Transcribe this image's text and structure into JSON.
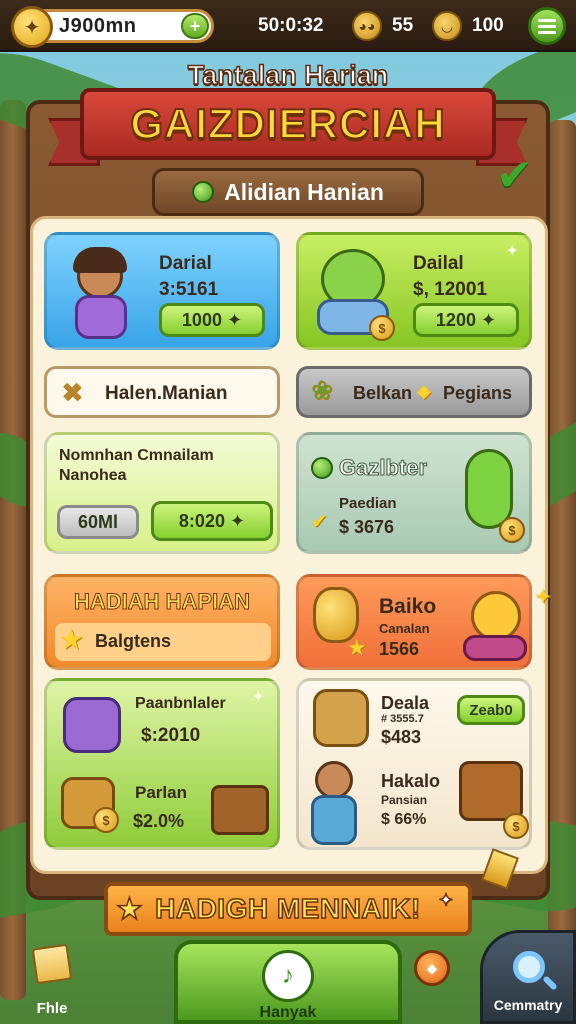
{
  "topbar": {
    "currency_left": "J900mn",
    "timer": "50:0:32",
    "currency_mid": "55",
    "currency_right": "100"
  },
  "header": {
    "title_small": "Tantalan Harian",
    "title_big": "GAIZDIERCIAH",
    "subheading": "Alidian Hanian"
  },
  "cards": {
    "c1": {
      "line1": "Darial",
      "line2": "3:5161",
      "btn": "1000"
    },
    "c2": {
      "line1": "Dailal",
      "line2": "$, 12001",
      "btn": "1200"
    },
    "tab_left": "Halen.Manian",
    "tab_right": "Belkan",
    "tab_right_2": "Pegians",
    "c3": {
      "line1": "Nomnhan Cmnailam",
      "line2": "Nanohea",
      "btn_grey": "60Ml",
      "btn_green": "8:020"
    },
    "c4": {
      "title": "Gazlbter",
      "line1": "Paedian",
      "line2": "$ 3676"
    },
    "c5": {
      "title": "HADIAH HAPIAN",
      "sub": "Balgtens"
    },
    "c6": {
      "title": "Baiko",
      "line1": "Canalan",
      "line2": "1566"
    },
    "c7": {
      "title": "Paanbnlaler",
      "price": "$:2010",
      "item2": "Parlan",
      "price2": "$2.0%"
    },
    "c8": {
      "title": "Deala",
      "line1": "# 3555.7",
      "line2": "$483",
      "btn": "Zeab0",
      "item2": "Hakalo",
      "line3": "Pansian",
      "line4": "$ 66%"
    }
  },
  "bottom": {
    "banner": "HADIGH MENNAIK!",
    "nav_left": "Fhle",
    "nav_main": "Hanyak",
    "nav_right": "Cemmatry"
  }
}
